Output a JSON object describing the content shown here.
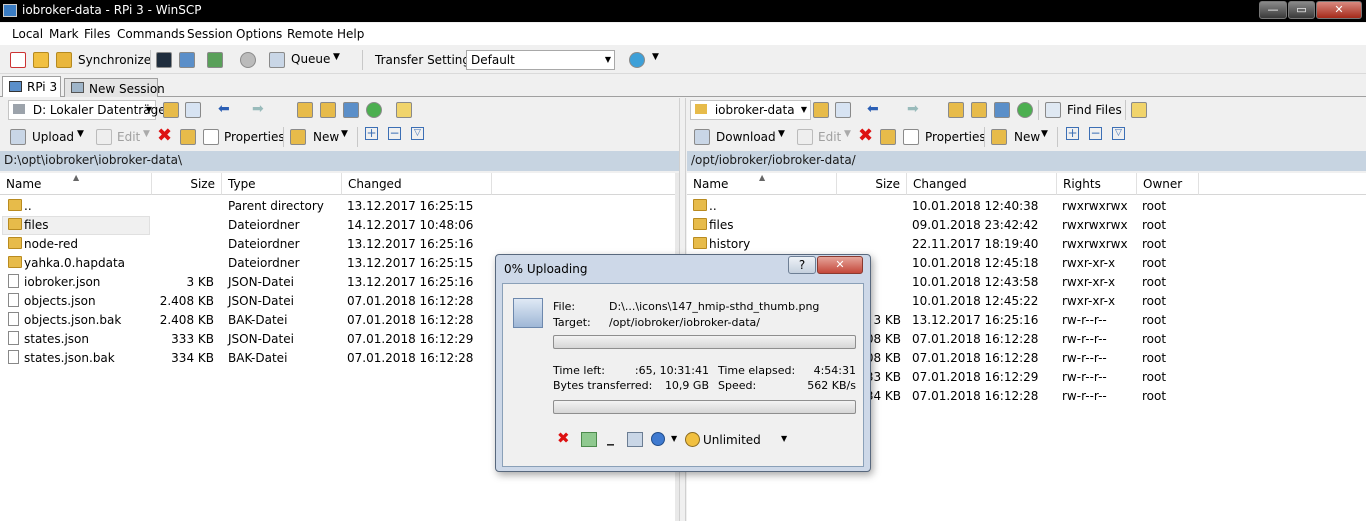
{
  "window": {
    "title": "iobroker-data - RPi 3 - WinSCP",
    "min": "—",
    "max": "▭",
    "close": "✕"
  },
  "menu": [
    "Local",
    "Mark",
    "Files",
    "Commands",
    "Session",
    "Options",
    "Remote",
    "Help"
  ],
  "toolbar": {
    "synchronize": "Synchronize",
    "queue": "Queue",
    "transfer_settings_label": "Transfer Settings",
    "transfer_settings_value": "Default"
  },
  "tabs": [
    "RPi 3",
    "New Session"
  ],
  "left": {
    "drive": "D: Lokaler Datenträge",
    "upload": "Upload",
    "edit": "Edit",
    "properties": "Properties",
    "new": "New",
    "path": "D:\\opt\\iobroker\\iobroker-data\\",
    "columns": [
      "Name",
      "Size",
      "Type",
      "Changed"
    ],
    "files": [
      {
        "name": "..",
        "size": "",
        "type": "Parent directory",
        "changed": "13.12.2017  16:25:15",
        "icon": "parent-folder"
      },
      {
        "name": "files",
        "size": "",
        "type": "Dateiordner",
        "changed": "14.12.2017  10:48:06",
        "icon": "folder"
      },
      {
        "name": "node-red",
        "size": "",
        "type": "Dateiordner",
        "changed": "13.12.2017  16:25:16",
        "icon": "folder"
      },
      {
        "name": "yahka.0.hapdata",
        "size": "",
        "type": "Dateiordner",
        "changed": "13.12.2017  16:25:15",
        "icon": "folder"
      },
      {
        "name": "iobroker.json",
        "size": "3 KB",
        "type": "JSON-Datei",
        "changed": "13.12.2017  16:25:16",
        "icon": "file"
      },
      {
        "name": "objects.json",
        "size": "2.408 KB",
        "type": "JSON-Datei",
        "changed": "07.01.2018  16:12:28",
        "icon": "file"
      },
      {
        "name": "objects.json.bak",
        "size": "2.408 KB",
        "type": "BAK-Datei",
        "changed": "07.01.2018  16:12:28",
        "icon": "file"
      },
      {
        "name": "states.json",
        "size": "333 KB",
        "type": "JSON-Datei",
        "changed": "07.01.2018  16:12:29",
        "icon": "file"
      },
      {
        "name": "states.json.bak",
        "size": "334 KB",
        "type": "BAK-Datei",
        "changed": "07.01.2018  16:12:28",
        "icon": "file"
      }
    ]
  },
  "right": {
    "dir": "iobroker-data",
    "find_files": "Find Files",
    "download": "Download",
    "edit": "Edit",
    "properties": "Properties",
    "new": "New",
    "path": "/opt/iobroker/iobroker-data/",
    "columns": [
      "Name",
      "Size",
      "Changed",
      "Rights",
      "Owner"
    ],
    "files": [
      {
        "name": "..",
        "size": "",
        "changed": "10.01.2018 12:40:38",
        "rights": "rwxrwxrwx",
        "owner": "root"
      },
      {
        "name": "files",
        "size": "",
        "changed": "09.01.2018 23:42:42",
        "rights": "rwxrwxrwx",
        "owner": "root"
      },
      {
        "name": "history",
        "size": "",
        "changed": "22.11.2017 18:19:40",
        "rights": "rwxrwxrwx",
        "owner": "root"
      },
      {
        "name": "",
        "size": "",
        "changed": "10.01.2018 12:45:18",
        "rights": "rwxr-xr-x",
        "owner": "root"
      },
      {
        "name": "",
        "size": "",
        "changed": "10.01.2018 12:43:58",
        "rights": "rwxr-xr-x",
        "owner": "root"
      },
      {
        "name": "",
        "size": "",
        "changed": "10.01.2018 12:45:22",
        "rights": "rwxr-xr-x",
        "owner": "root"
      },
      {
        "name": "",
        "size": "3 KB",
        "changed": "13.12.2017 16:25:16",
        "rights": "rw-r--r--",
        "owner": "root"
      },
      {
        "name": "",
        "size": "08 KB",
        "changed": "07.01.2018 16:12:28",
        "rights": "rw-r--r--",
        "owner": "root"
      },
      {
        "name": "",
        "size": "08 KB",
        "changed": "07.01.2018 16:12:28",
        "rights": "rw-r--r--",
        "owner": "root"
      },
      {
        "name": "",
        "size": "33 KB",
        "changed": "07.01.2018 16:12:29",
        "rights": "rw-r--r--",
        "owner": "root"
      },
      {
        "name": "",
        "size": "34 KB",
        "changed": "07.01.2018 16:12:28",
        "rights": "rw-r--r--",
        "owner": "root"
      }
    ]
  },
  "dialog": {
    "title": "0% Uploading",
    "help": "?",
    "minimize": "—",
    "close": "✕",
    "file_label": "File:",
    "file_value": "D:\\...\\icons\\147_hmip-sthd_thumb.png",
    "target_label": "Target:",
    "target_value": "/opt/iobroker/iobroker-data/",
    "file_progress": 0,
    "time_left_label": "Time left:",
    "time_left_value": ":65, 10:31:41",
    "time_elapsed_label": "Time elapsed:",
    "time_elapsed_value": "4:54:31",
    "bytes_label": "Bytes transferred:",
    "bytes_value": "10,9 GB",
    "speed_label": "Speed:",
    "speed_value": "562 KB/s",
    "total_progress": 0,
    "speed_limit": "Unlimited"
  }
}
